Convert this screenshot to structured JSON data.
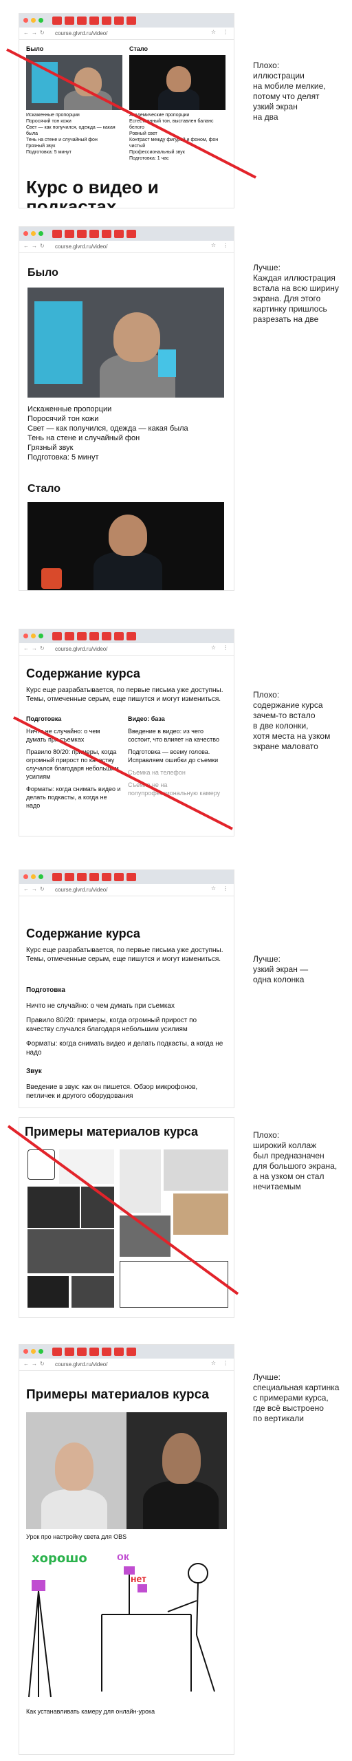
{
  "browser": {
    "url": "course.glvrd.ru/video/"
  },
  "panels": [
    {
      "note": "Плохо:\nиллюстрации\nна мобиле мелкие,\nпотому что делят\nузкий экран\nна два",
      "before_label": "Было",
      "after_label": "Стало",
      "before_lines": [
        "Искаженные пропорции",
        "Поросячий тон кожи",
        "Свет — как получился, одежда — какая была",
        "Тень на стене и случайный фон",
        "Грязный звук",
        "Подготовка: 5 минут"
      ],
      "after_lines": [
        "Академические пропорции",
        "Естественный тон, выставлен баланс белого",
        "Ровный свет",
        "Контраст между фигурой и фоном, фон чистый",
        "Профессиональный звук",
        "Подготовка: 1 час"
      ],
      "course_title": "Курс о видео и подкастах"
    },
    {
      "note": "Лучше:\nКаждая иллюстрация\nвстала на всю ширину\nэкрана. Для этого\nкартинку пришлось\nразрезать на две",
      "before_label": "Было",
      "before_lines": [
        "Искаженные пропорции",
        "Поросячий тон кожи",
        "Свет — как получился, одежда — какая была",
        "Тень на стене и случайный фон",
        "Грязный звук",
        "Подготовка: 5 минут"
      ],
      "after_label": "Стало"
    },
    {
      "note": "Плохо:\nсодержание курса\nзачем-то встало\nв две колонки,\nхотя места на узком\nэкране маловато",
      "title": "Содержание курса",
      "intro": "Курс еще разрабатывается, по первые письма уже доступны. Темы, отмеченные серым, еще пишутся и могут измениться.",
      "col1_title": "Подготовка",
      "col1_items": [
        "Ничто не случайно: о чем думать при съемках",
        "Правило 80/20: примеры, когда огромный прирост по качеству случался благодаря небольшим усилиям",
        "Форматы: когда снимать видео и делать подкасты, а когда не надо"
      ],
      "col2_title": "Видео: база",
      "col2_items": [
        "Введение в видео: из чего состоит, что влияет на качество",
        "Подготовка — всему голова. Исправляем ошибки до съемки"
      ],
      "col2_gray": [
        "Съемка на телефон",
        "Съемка не на полупрофессиональную камеру"
      ]
    },
    {
      "note": "Лучше:\nузкий экран —\nодна колонка",
      "title": "Содержание курса",
      "intro": "Курс еще разрабатывается, по первые письма уже доступны. Темы, отмеченные серым, еще пишутся и могут измениться.",
      "section1": "Подготовка",
      "items1": [
        "Ничто не случайно: о чем думать при съемках",
        "Правило 80/20: примеры, когда огромный прирост по качеству случался благодаря небольшим усилиям",
        "Форматы: когда снимать видео и делать подкасты, а когда не надо"
      ],
      "section2": "Звук",
      "items2": [
        "Введение в звук: как он пишется. Обзор микрофонов, петличек и другого оборудования"
      ]
    },
    {
      "note": "Плохо:\nширокий коллаж\nбыл предназначен\nдля большого экрана,\nа на узком он стал\nнечитаемым",
      "title": "Примеры материалов курса"
    },
    {
      "note": "Лучше:\nспециальная картинка\nс примерами курса,\nгде всё выстроено\nпо вертикали",
      "title": "Примеры материалов курса",
      "caption1": "Урок про настройку света для OBS",
      "label_good": "хорошо",
      "label_ok": "ок",
      "label_no": "нет",
      "caption2": "Как устанавливать камеру для онлайн-урока"
    }
  ],
  "colors": {
    "red_cross": "#e2232a",
    "dot_red": "#ff5f57",
    "dot_yellow": "#febc2e",
    "dot_green": "#28c840",
    "tab_red": "#e53935"
  }
}
